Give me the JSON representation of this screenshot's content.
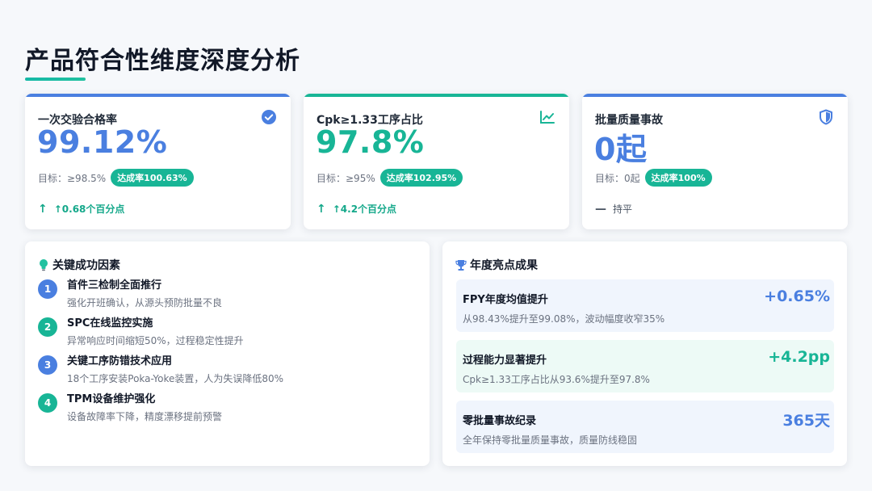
{
  "page": {
    "title": "产品符合性维度深度分析"
  },
  "colors": {
    "blue": "#4a7fe0",
    "teal": "#18b596",
    "dark_text": "#111827"
  },
  "kpis": [
    {
      "label": "一次交验合格率",
      "value": "99.12%",
      "target": "目标：≥98.5%",
      "rate": "达成率100.63%",
      "change": "↑0.68个百分点",
      "icon": "check-circle-icon",
      "change_icon": "arrow-up-icon"
    },
    {
      "label": "Cpk≥1.33工序占比",
      "value": "97.8%",
      "target": "目标：≥95%",
      "rate": "达成率102.95%",
      "change": "↑4.2个百分点",
      "icon": "line-chart-icon",
      "change_icon": "arrow-up-icon"
    },
    {
      "label": "批量质量事故",
      "value": "0起",
      "target": "目标：0起",
      "rate": "达成率100%",
      "change": "持平",
      "icon": "shield-icon",
      "change_icon": "minus-icon"
    }
  ],
  "factors": {
    "title": "关键成功因素",
    "items": [
      {
        "num": "1",
        "title": "首件三检制全面推行",
        "desc": "强化开班确认，从源头预防批量不良"
      },
      {
        "num": "2",
        "title": "SPC在线监控实施",
        "desc": "异常响应时间缩短50%，过程稳定性提升"
      },
      {
        "num": "3",
        "title": "关键工序防错技术应用",
        "desc": "18个工序安装Poka-Yoke装置，人为失误降低80%"
      },
      {
        "num": "4",
        "title": "TPM设备维护强化",
        "desc": "设备故障率下降，精度漂移提前预警"
      }
    ]
  },
  "achievements": {
    "title": "年度亮点成果",
    "items": [
      {
        "title": "FPY年度均值提升",
        "desc": "从98.43%提升至99.08%，波动幅度收窄35%",
        "value": "+0.65%"
      },
      {
        "title": "过程能力显著提升",
        "desc": "Cpk≥1.33工序占比从93.6%提升至97.8%",
        "value": "+4.2pp"
      },
      {
        "title": "零批量事故纪录",
        "desc": "全年保持零批量质量事故，质量防线稳固",
        "value": "365天"
      }
    ]
  }
}
